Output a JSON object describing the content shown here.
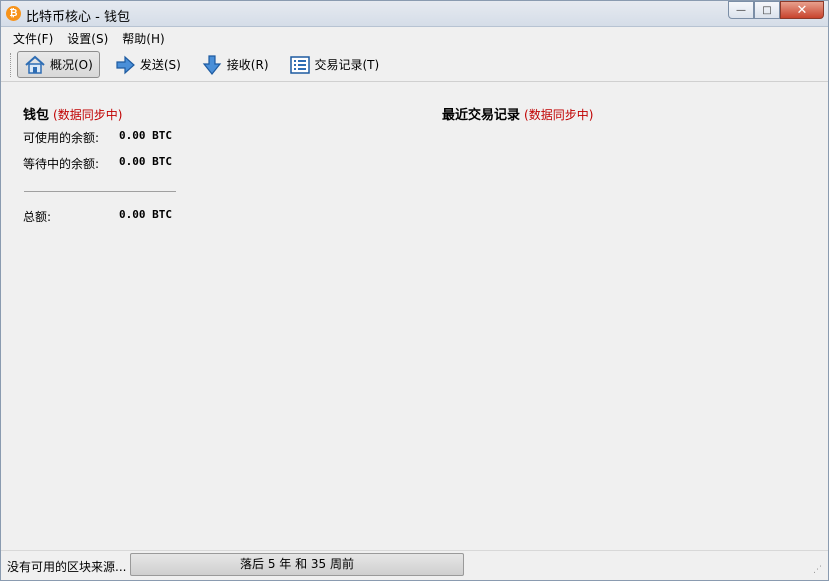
{
  "window": {
    "title": "比特币核心 - 钱包",
    "icon": "bitcoin-icon",
    "icon_glyph": "₿"
  },
  "titlebar_buttons": {
    "minimize": "—",
    "maximize": "□",
    "close": "✕"
  },
  "menu": [
    "文件(F)",
    "设置(S)",
    "帮助(H)"
  ],
  "toolbar": [
    {
      "label": "概况(O)",
      "icon": "home-icon",
      "active": true
    },
    {
      "label": "发送(S)",
      "icon": "arrow-right-icon",
      "active": false
    },
    {
      "label": "接收(R)",
      "icon": "arrow-down-icon",
      "active": false
    },
    {
      "label": "交易记录(T)",
      "icon": "list-icon",
      "active": false
    }
  ],
  "wallet": {
    "title": "钱包",
    "sync_status": "(数据同步中)",
    "available_label": "可使用的余额:",
    "available_value": "0.00 BTC",
    "pending_label": "等待中的余额:",
    "pending_value": "0.00 BTC",
    "total_label": "总额:",
    "total_value": "0.00 BTC"
  },
  "recent": {
    "title": "最近交易记录",
    "sync_status": "(数据同步中)"
  },
  "statusbar": {
    "message": "没有可用的区块来源...",
    "progress_text": "落后 5 年 和 35 周前",
    "progress": 0
  },
  "colors": {
    "sync_red": "#c00000",
    "accent_blue": "#2e6db4",
    "bitcoin_orange": "#f7931a"
  }
}
